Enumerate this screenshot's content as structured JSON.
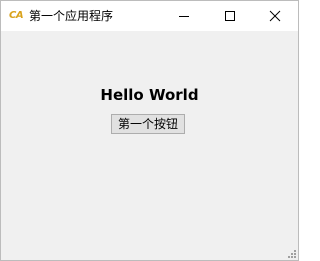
{
  "window": {
    "icon_text": "CA",
    "title": "第一个应用程序"
  },
  "controls": {
    "minimize": "minimize-icon",
    "maximize": "maximize-icon",
    "close": "close-icon"
  },
  "main": {
    "heading": "Hello World",
    "button_label": "第一个按钮"
  },
  "colors": {
    "icon_accent": "#d9a21b",
    "client_bg": "#f0f0f0",
    "button_bg": "#e1e1e1",
    "button_border": "#adadad"
  }
}
